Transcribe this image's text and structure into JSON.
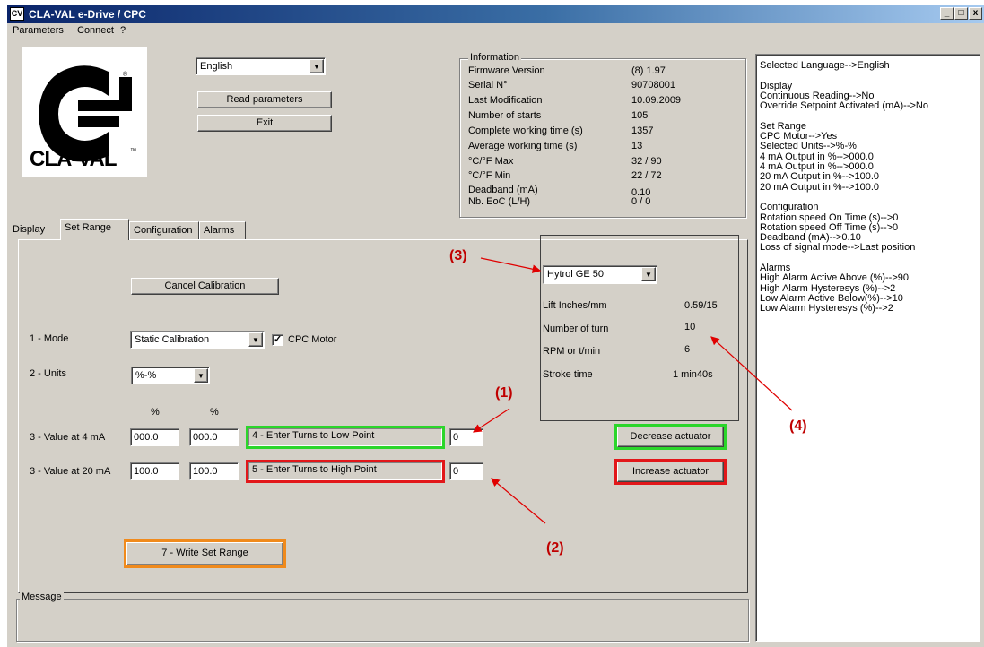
{
  "window": {
    "title": "CLA-VAL e-Drive / CPC",
    "icon_label": "CV",
    "controls": [
      "_",
      "□",
      "x"
    ]
  },
  "menu": [
    "Parameters",
    "Connect",
    "?"
  ],
  "logo": {
    "text": "CLA-VAL",
    "registered": "®",
    "trademark": "™"
  },
  "header": {
    "language": "English",
    "read_button": "Read parameters",
    "exit_button": "Exit"
  },
  "info": {
    "legend": "Information",
    "rows": [
      {
        "label": "Firmware Version",
        "value": "(8) 1.97"
      },
      {
        "label": "Serial N°",
        "value": "90708001"
      },
      {
        "label": "Last Modification",
        "value": "10.09.2009"
      },
      {
        "label": "Number of starts",
        "value": "105"
      },
      {
        "label": "Complete working time (s)",
        "value": "1357"
      },
      {
        "label": "Average working time (s)",
        "value": "13"
      },
      {
        "label": "°C/°F Max",
        "value": "32 / 90"
      },
      {
        "label": "°C/°F Min",
        "value": "22 / 72"
      },
      {
        "label": "Deadband (mA)",
        "value": "0.10"
      },
      {
        "label": "Nb. EoC (L/H)",
        "value": "0 / 0"
      }
    ]
  },
  "tabs": [
    "Display",
    "Set Range",
    "Configuration",
    "Alarms"
  ],
  "set_range": {
    "cancel_button": "Cancel Calibration",
    "mode_label": "1 - Mode",
    "mode_value": "Static Calibration",
    "cpc_motor_label": "CPC Motor",
    "cpc_motor_checked": true,
    "units_label": "2 - Units",
    "units_value": "%-%",
    "pct1": "%",
    "pct2": "%",
    "row4": {
      "label": "3 - Value at 4 mA",
      "v1": "000.0",
      "v2": "000.0",
      "turns_label": "4 - Enter Turns to Low Point",
      "turns_value": "0"
    },
    "row20": {
      "label": "3 - Value at 20 mA",
      "v1": "100.0",
      "v2": "100.0",
      "turns_label": "5 - Enter Turns to High Point",
      "turns_value": "0"
    },
    "decrease_button": "Decrease actuator",
    "increase_button": "Increase actuator",
    "write_button": "7 - Write Set Range",
    "valve": {
      "model": "Hytrol GE 50",
      "rows": [
        {
          "label": "Lift Inches/mm",
          "value": "0.59/15"
        },
        {
          "label": "Number of turn",
          "value": "10"
        },
        {
          "label": "RPM or t/min",
          "value": "6"
        },
        {
          "label": "Stroke time",
          "value": "1 min40s"
        }
      ]
    }
  },
  "summary": [
    "Selected Language-->English",
    "",
    "Display",
    "Continuous Reading-->No",
    "Override Setpoint Activated (mA)-->No",
    "",
    "Set Range",
    "CPC Motor-->Yes",
    "Selected Units-->%-%",
    "4 mA Output in %-->000.0",
    "4 mA Output in %-->000.0",
    "20 mA Output in %-->100.0",
    "20 mA Output in %-->100.0",
    "",
    "Configuration",
    "Rotation speed On Time (s)-->0",
    "Rotation speed Off Time (s)-->0",
    "Deadband (mA)-->0.10",
    "Loss of signal mode-->Last position",
    "",
    "Alarms",
    "High Alarm Active Above (%)-->90",
    "High Alarm Hysteresys (%)-->2",
    "Low Alarm Active Below(%)-->10",
    "Low Alarm Hysteresys (%)-->2"
  ],
  "message": {
    "legend": "Message",
    "text": ""
  },
  "callouts": [
    "(1)",
    "(2)",
    "(3)",
    "(4)"
  ],
  "colors": {
    "green": "#2bd62b",
    "red": "#e2171a",
    "orange": "#f08a1c",
    "callout": "#c00000"
  }
}
